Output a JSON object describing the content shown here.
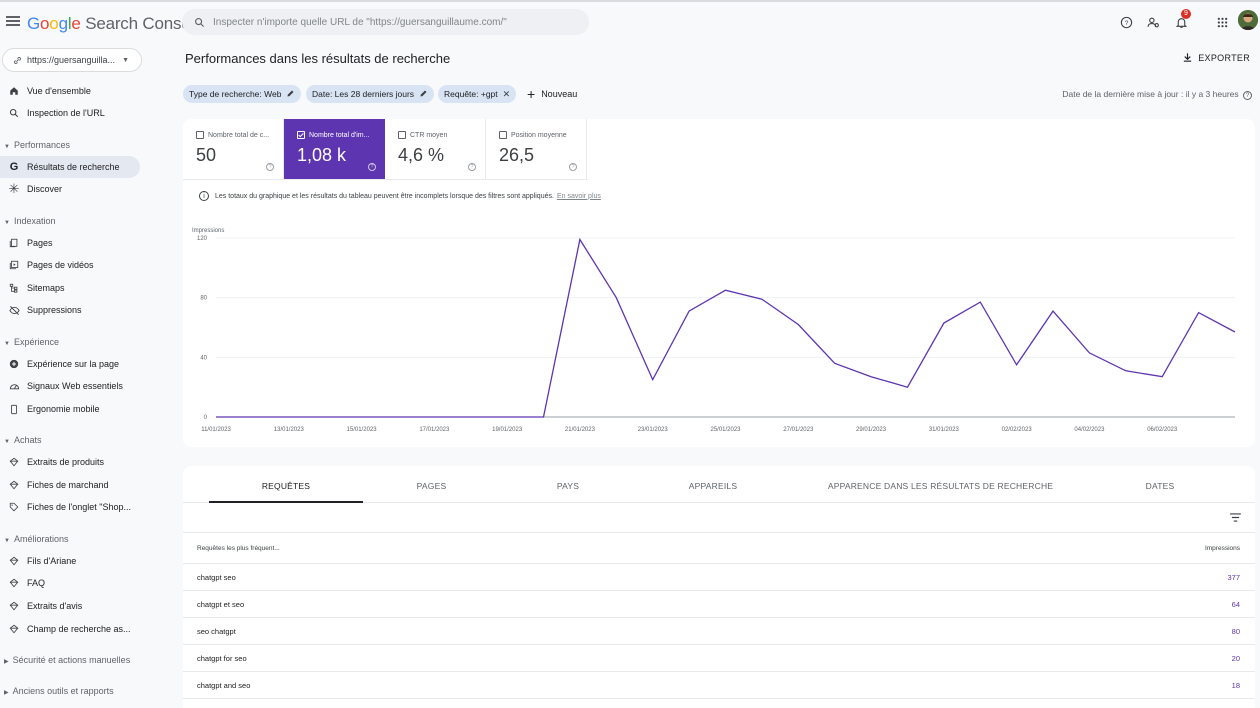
{
  "app": {
    "logo_google": [
      "G",
      "o",
      "o",
      "g",
      "l",
      "e"
    ],
    "logo_product": "Search Console",
    "search_placeholder": "Inspecter n'importe quelle URL de \"https://guersanguillaume.com/\"",
    "notification_count": "9",
    "icons": [
      "menu-icon",
      "search-icon",
      "help-icon",
      "users-icon",
      "bell-icon",
      "apps-icon",
      "avatar"
    ]
  },
  "sidebar": {
    "property": "https://guersanguilla...",
    "items": [
      {
        "label": "Vue d'ensemble",
        "icon": "home-icon"
      },
      {
        "label": "Inspection de l'URL",
        "icon": "search-icon"
      },
      {
        "label": "Résultats de recherche",
        "icon": "google-g-icon",
        "active": true
      },
      {
        "label": "Discover",
        "icon": "asterisk-icon"
      },
      {
        "label": "Pages",
        "icon": "pages-icon"
      },
      {
        "label": "Pages de vidéos",
        "icon": "video-pages-icon"
      },
      {
        "label": "Sitemaps",
        "icon": "sitemap-icon"
      },
      {
        "label": "Suppressions",
        "icon": "eye-off-icon"
      },
      {
        "label": "Expérience sur la page",
        "icon": "plus-circle-icon"
      },
      {
        "label": "Signaux Web essentiels",
        "icon": "gauge-icon"
      },
      {
        "label": "Ergonomie mobile",
        "icon": "phone-icon"
      },
      {
        "label": "Extraits de produits",
        "icon": "diamond-icon"
      },
      {
        "label": "Fiches de marchand",
        "icon": "diamond-icon"
      },
      {
        "label": "Fiches de l'onglet \"Shop...",
        "icon": "tag-icon"
      },
      {
        "label": "Fils d'Ariane",
        "icon": "diamond-icon"
      },
      {
        "label": "FAQ",
        "icon": "diamond-icon"
      },
      {
        "label": "Extraits d'avis",
        "icon": "diamond-icon"
      },
      {
        "label": "Champ de recherche as...",
        "icon": "diamond-icon"
      }
    ],
    "sections": [
      "Performances",
      "Indexation",
      "Expérience",
      "Achats",
      "Améliorations",
      "Sécurité et actions manuelles",
      "Anciens outils et rapports"
    ]
  },
  "main": {
    "title": "Performances dans les résultats de recherche",
    "export_label": "EXPORTER",
    "chips": [
      "Type de recherche: Web",
      "Date: Les 28 derniers jours",
      "Requête: +gpt"
    ],
    "new_label": "Nouveau",
    "last_update": "Date de la dernière mise à jour : il y a 3 heures",
    "metrics": [
      {
        "label": "Nombre total de c...",
        "value": "50",
        "selected": false
      },
      {
        "label": "Nombre total d'im...",
        "value": "1,08 k",
        "selected": true
      },
      {
        "label": "CTR moyen",
        "value": "4,6 %",
        "selected": false
      },
      {
        "label": "Position moyenne",
        "value": "26,5",
        "selected": false
      }
    ],
    "info_text": "Les totaux du graphique et les résultats du tableau peuvent être incomplets lorsque des filtres sont appliqués.",
    "info_link": "En savoir plus"
  },
  "chart_data": {
    "type": "line",
    "ylabel": "Impressions",
    "ylim": [
      0,
      120
    ],
    "yticks": [
      "120",
      "80",
      "40",
      "0"
    ],
    "xtick_labels": [
      "11/01/2023",
      "13/01/2023",
      "15/01/2023",
      "17/01/2023",
      "19/01/2023",
      "21/01/2023",
      "23/01/2023",
      "25/01/2023",
      "27/01/2023",
      "29/01/2023",
      "31/01/2023",
      "02/02/2023",
      "04/02/2023",
      "06/02/2023"
    ],
    "x": [
      "11/01",
      "12/01",
      "13/01",
      "14/01",
      "15/01",
      "16/01",
      "17/01",
      "18/01",
      "19/01",
      "20/01",
      "21/01",
      "22/01",
      "23/01",
      "24/01",
      "25/01",
      "26/01",
      "27/01",
      "28/01",
      "29/01",
      "30/01",
      "31/01",
      "01/02",
      "02/02",
      "03/02",
      "04/02",
      "05/02",
      "06/02",
      "07/02"
    ],
    "series": [
      {
        "color": "#5e35b1",
        "values": [
          0,
          0,
          0,
          0,
          0,
          0,
          0,
          0,
          0,
          0,
          119,
          80,
          25,
          71,
          85,
          79,
          62,
          36,
          27,
          20,
          63,
          77,
          35,
          71,
          43,
          31,
          27,
          70,
          57
        ]
      }
    ],
    "grid": true
  },
  "table": {
    "tabs": [
      "REQUÊTES",
      "PAGES",
      "PAYS",
      "APPAREILS",
      "APPARENCE DANS LES RÉSULTATS DE RECHERCHE",
      "DATES"
    ],
    "col_query": "Requêtes les plus fréquent...",
    "col_impr": "Impressions",
    "rows": [
      {
        "q": "chatgpt seo",
        "n": "377"
      },
      {
        "q": "chatgpt et seo",
        "n": "64"
      },
      {
        "q": "seo chatgpt",
        "n": "80"
      },
      {
        "q": "chatgpt for seo",
        "n": "20"
      },
      {
        "q": "chatgpt and seo",
        "n": "18"
      }
    ]
  }
}
